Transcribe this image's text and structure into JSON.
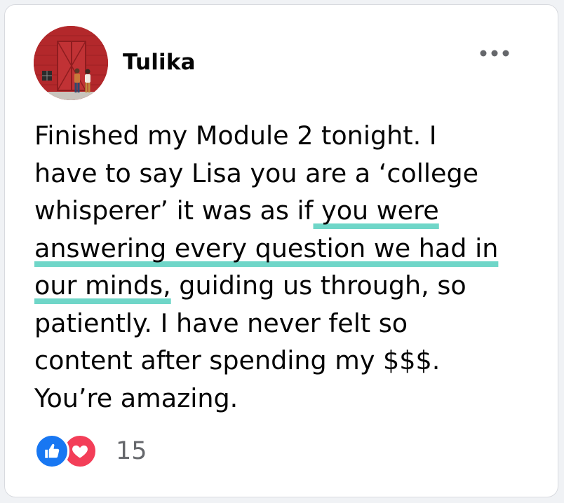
{
  "post": {
    "author": "Tulika",
    "lines": [
      {
        "before": "Finished my Module 2 tonight. I",
        "highlight": "",
        "after": ""
      },
      {
        "before": "have to say Lisa you are a ‘college",
        "highlight": "",
        "after": ""
      },
      {
        "before": "whisperer’ it was as if",
        "highlight": " you were",
        "after": ""
      },
      {
        "before": "",
        "highlight": "answering every question we had in",
        "after": ""
      },
      {
        "before": "",
        "highlight": "our minds,",
        "after": " guiding us through, so"
      },
      {
        "before": "patiently. I have never felt so",
        "highlight": "",
        "after": ""
      },
      {
        "before": "content after spending my $$$.",
        "highlight": "",
        "after": ""
      },
      {
        "before": "You’re amazing.",
        "highlight": "",
        "after": ""
      }
    ],
    "reactions": {
      "count": "15",
      "icons": [
        "like-icon",
        "love-icon"
      ]
    },
    "more_icon": "more-horizontal-icon"
  },
  "colors": {
    "highlight_underline": "#6fd6c8",
    "like": "#1877f2",
    "love": "#f33e58",
    "avatar_background": "#b52a2c"
  }
}
